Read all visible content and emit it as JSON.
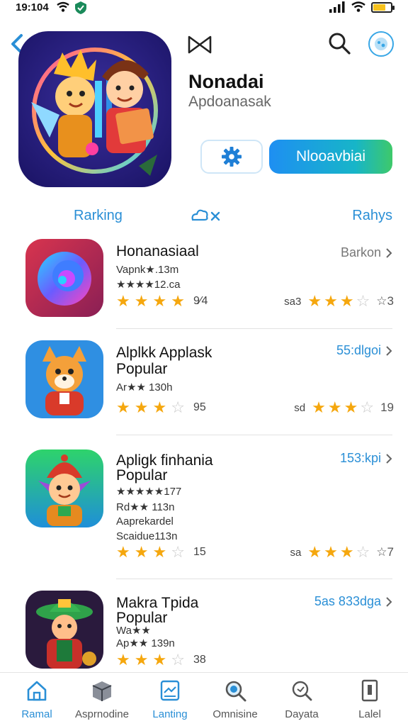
{
  "status_bar": {
    "time": "19:104"
  },
  "header": {
    "app_name": "Nonadai",
    "app_subtitle": "Apdoanasak",
    "download_label": "Nlooavbiai"
  },
  "tabs": {
    "left": "Rarking",
    "right": "Rahys"
  },
  "apps": [
    {
      "title": "Honanasiaal",
      "lines": [
        "Vapnk★.13m",
        "★★★★12.ca"
      ],
      "right_label": "Barkon",
      "right_color": "gray",
      "stars": 4,
      "stars_count": "9⁄4",
      "rating_pre": "sa3",
      "rating_stars": 3,
      "rating_post": "☆3"
    },
    {
      "title": "Alplkk Applask",
      "lines": [
        "Popular",
        "Ar★★ 130h"
      ],
      "right_label": "55:dlgoi",
      "right_color": "blue",
      "stars": 3,
      "stars_count": "95",
      "rating_pre": "sd",
      "rating_stars": 3,
      "rating_post": "19"
    },
    {
      "title": "Apligk finhania",
      "lines": [
        "Popular",
        "★★★★★177",
        "Rd★★ 113n",
        "Aaprekardel",
        "Scaidue113n"
      ],
      "right_label": "153:kpi",
      "right_color": "blue",
      "stars": 3,
      "stars_count": "15",
      "rating_pre": "sa",
      "rating_stars": 3,
      "rating_post": "☆7"
    },
    {
      "title": "Makra Tpida",
      "lines": [
        "Popular",
        "Wa★★",
        "Ap★★ 139n"
      ],
      "right_label": "5as 833dga",
      "right_color": "blue",
      "stars": 3,
      "stars_count": "38",
      "rating_pre": "",
      "rating_stars": 0,
      "rating_post": ""
    }
  ],
  "bottom_nav": [
    {
      "label": "Ramal",
      "icon": "home-icon",
      "active": true
    },
    {
      "label": "Asprnodine",
      "icon": "box-icon",
      "active": false
    },
    {
      "label": "Lanting",
      "icon": "chart-icon",
      "active": true
    },
    {
      "label": "Omnisine",
      "icon": "search-icon",
      "active": false
    },
    {
      "label": "Dayata",
      "icon": "magnifier-icon",
      "active": false
    },
    {
      "label": "Lalel",
      "icon": "document-icon",
      "active": false
    }
  ],
  "colors": {
    "accent": "#2a8fd6",
    "star": "#f5a70e",
    "download_start": "#1e8ff2",
    "download_end": "#3ec96a"
  }
}
